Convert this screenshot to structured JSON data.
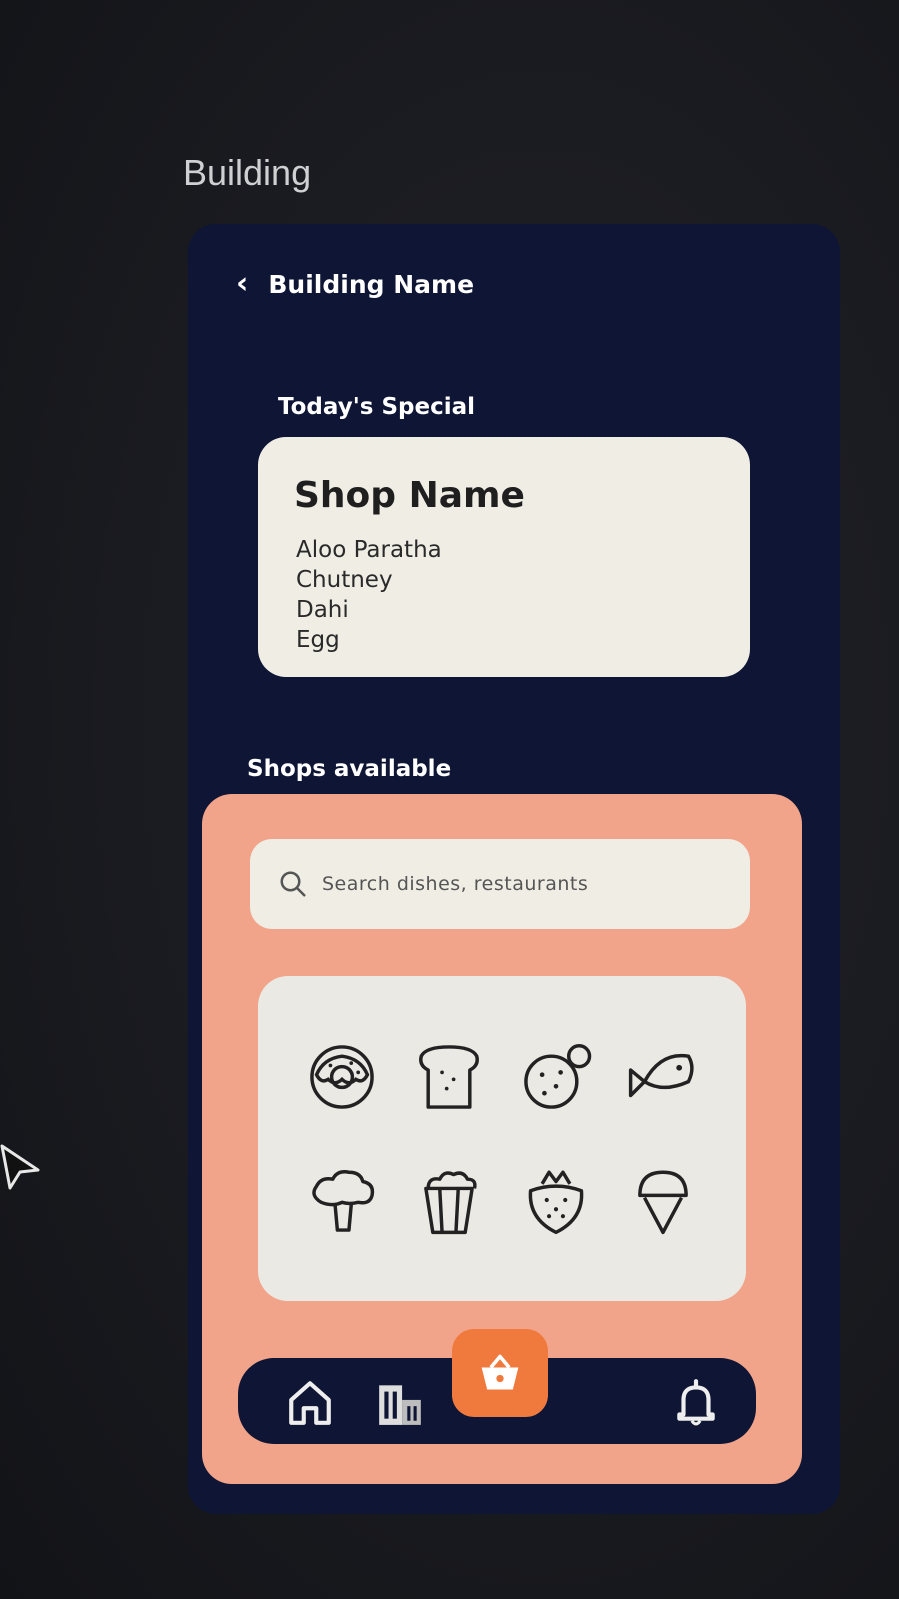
{
  "frame": {
    "label": "Building"
  },
  "header": {
    "back_icon": "chevron-left-icon",
    "title": "Building Name"
  },
  "special": {
    "section_label": "Today's Special",
    "shop_name": "Shop Name",
    "items": [
      "Aloo Paratha",
      "Chutney",
      "Dahi",
      "Egg"
    ]
  },
  "shops": {
    "section_label": "Shops available",
    "search": {
      "icon": "search-icon",
      "placeholder": "Search dishes, restaurants"
    },
    "categories": [
      {
        "icon": "donut-icon"
      },
      {
        "icon": "bread-icon"
      },
      {
        "icon": "cookie-icon"
      },
      {
        "icon": "fish-icon"
      },
      {
        "icon": "broccoli-icon"
      },
      {
        "icon": "popcorn-icon"
      },
      {
        "icon": "strawberry-icon"
      },
      {
        "icon": "ice-cream-icon"
      }
    ]
  },
  "nav": {
    "items": [
      {
        "icon": "home-icon"
      },
      {
        "icon": "building-icon"
      },
      {
        "icon": "basket-icon",
        "active": true
      },
      {
        "icon": "bell-icon"
      }
    ]
  },
  "colors": {
    "background": "#1a1b20",
    "phone": "#0e1535",
    "card": "#efede4",
    "panel": "#f1a489",
    "accent": "#f07a3e"
  }
}
